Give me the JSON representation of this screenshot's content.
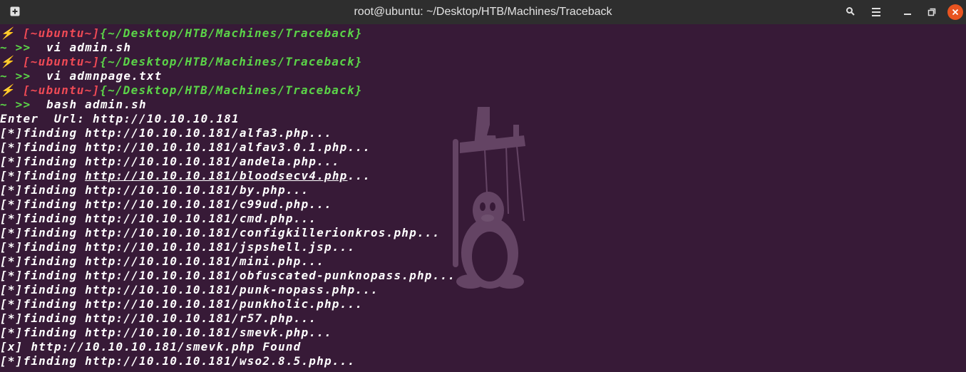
{
  "window": {
    "title": "root@ubuntu: ~/Desktop/HTB/Machines/Traceback"
  },
  "icons": {
    "new_tab": "plus-square-icon",
    "search": "search-icon",
    "menu": "hamburger-icon",
    "minimize": "minimize-icon",
    "maximize": "maximize-icon",
    "close": "close-icon"
  },
  "colors": {
    "background": "#371a37",
    "prompt_user": "#ef4a55",
    "prompt_path": "#5bd448",
    "prompt_bolt": "#f5c542",
    "close_button": "#e95420"
  },
  "prompt": {
    "bolt": "⚡",
    "user": "[~ubuntu~]",
    "path": "{~/Desktop/HTB/Machines/Traceback}",
    "arrow": "~ >>"
  },
  "lines": [
    {
      "type": "prompt"
    },
    {
      "type": "command",
      "text": "  vi admin.sh"
    },
    {
      "type": "prompt"
    },
    {
      "type": "command",
      "text": "  vi admnpage.txt"
    },
    {
      "type": "prompt"
    },
    {
      "type": "command",
      "text": "  bash admin.sh"
    },
    {
      "type": "output",
      "text": "Enter  Url: http://10.10.10.181"
    },
    {
      "type": "output",
      "text": "[*]finding http://10.10.10.181/alfa3.php..."
    },
    {
      "type": "output",
      "text": "[*]finding http://10.10.10.181/alfav3.0.1.php..."
    },
    {
      "type": "output",
      "text": "[*]finding http://10.10.10.181/andela.php..."
    },
    {
      "type": "output_link",
      "prefix": "[*]finding ",
      "link": "http://10.10.10.181/bloodsecv4.php",
      "suffix": "..."
    },
    {
      "type": "output",
      "text": "[*]finding http://10.10.10.181/by.php..."
    },
    {
      "type": "output",
      "text": "[*]finding http://10.10.10.181/c99ud.php..."
    },
    {
      "type": "output",
      "text": "[*]finding http://10.10.10.181/cmd.php..."
    },
    {
      "type": "output",
      "text": "[*]finding http://10.10.10.181/configkillerionkros.php..."
    },
    {
      "type": "output",
      "text": "[*]finding http://10.10.10.181/jspshell.jsp..."
    },
    {
      "type": "output",
      "text": "[*]finding http://10.10.10.181/mini.php..."
    },
    {
      "type": "output",
      "text": "[*]finding http://10.10.10.181/obfuscated-punknopass.php..."
    },
    {
      "type": "output",
      "text": "[*]finding http://10.10.10.181/punk-nopass.php..."
    },
    {
      "type": "output",
      "text": "[*]finding http://10.10.10.181/punkholic.php..."
    },
    {
      "type": "output",
      "text": "[*]finding http://10.10.10.181/r57.php..."
    },
    {
      "type": "output",
      "text": "[*]finding http://10.10.10.181/smevk.php..."
    },
    {
      "type": "output",
      "text": "[x] http://10.10.10.181/smevk.php Found"
    },
    {
      "type": "output",
      "text": "[*]finding http://10.10.10.181/wso2.8.5.php..."
    }
  ]
}
